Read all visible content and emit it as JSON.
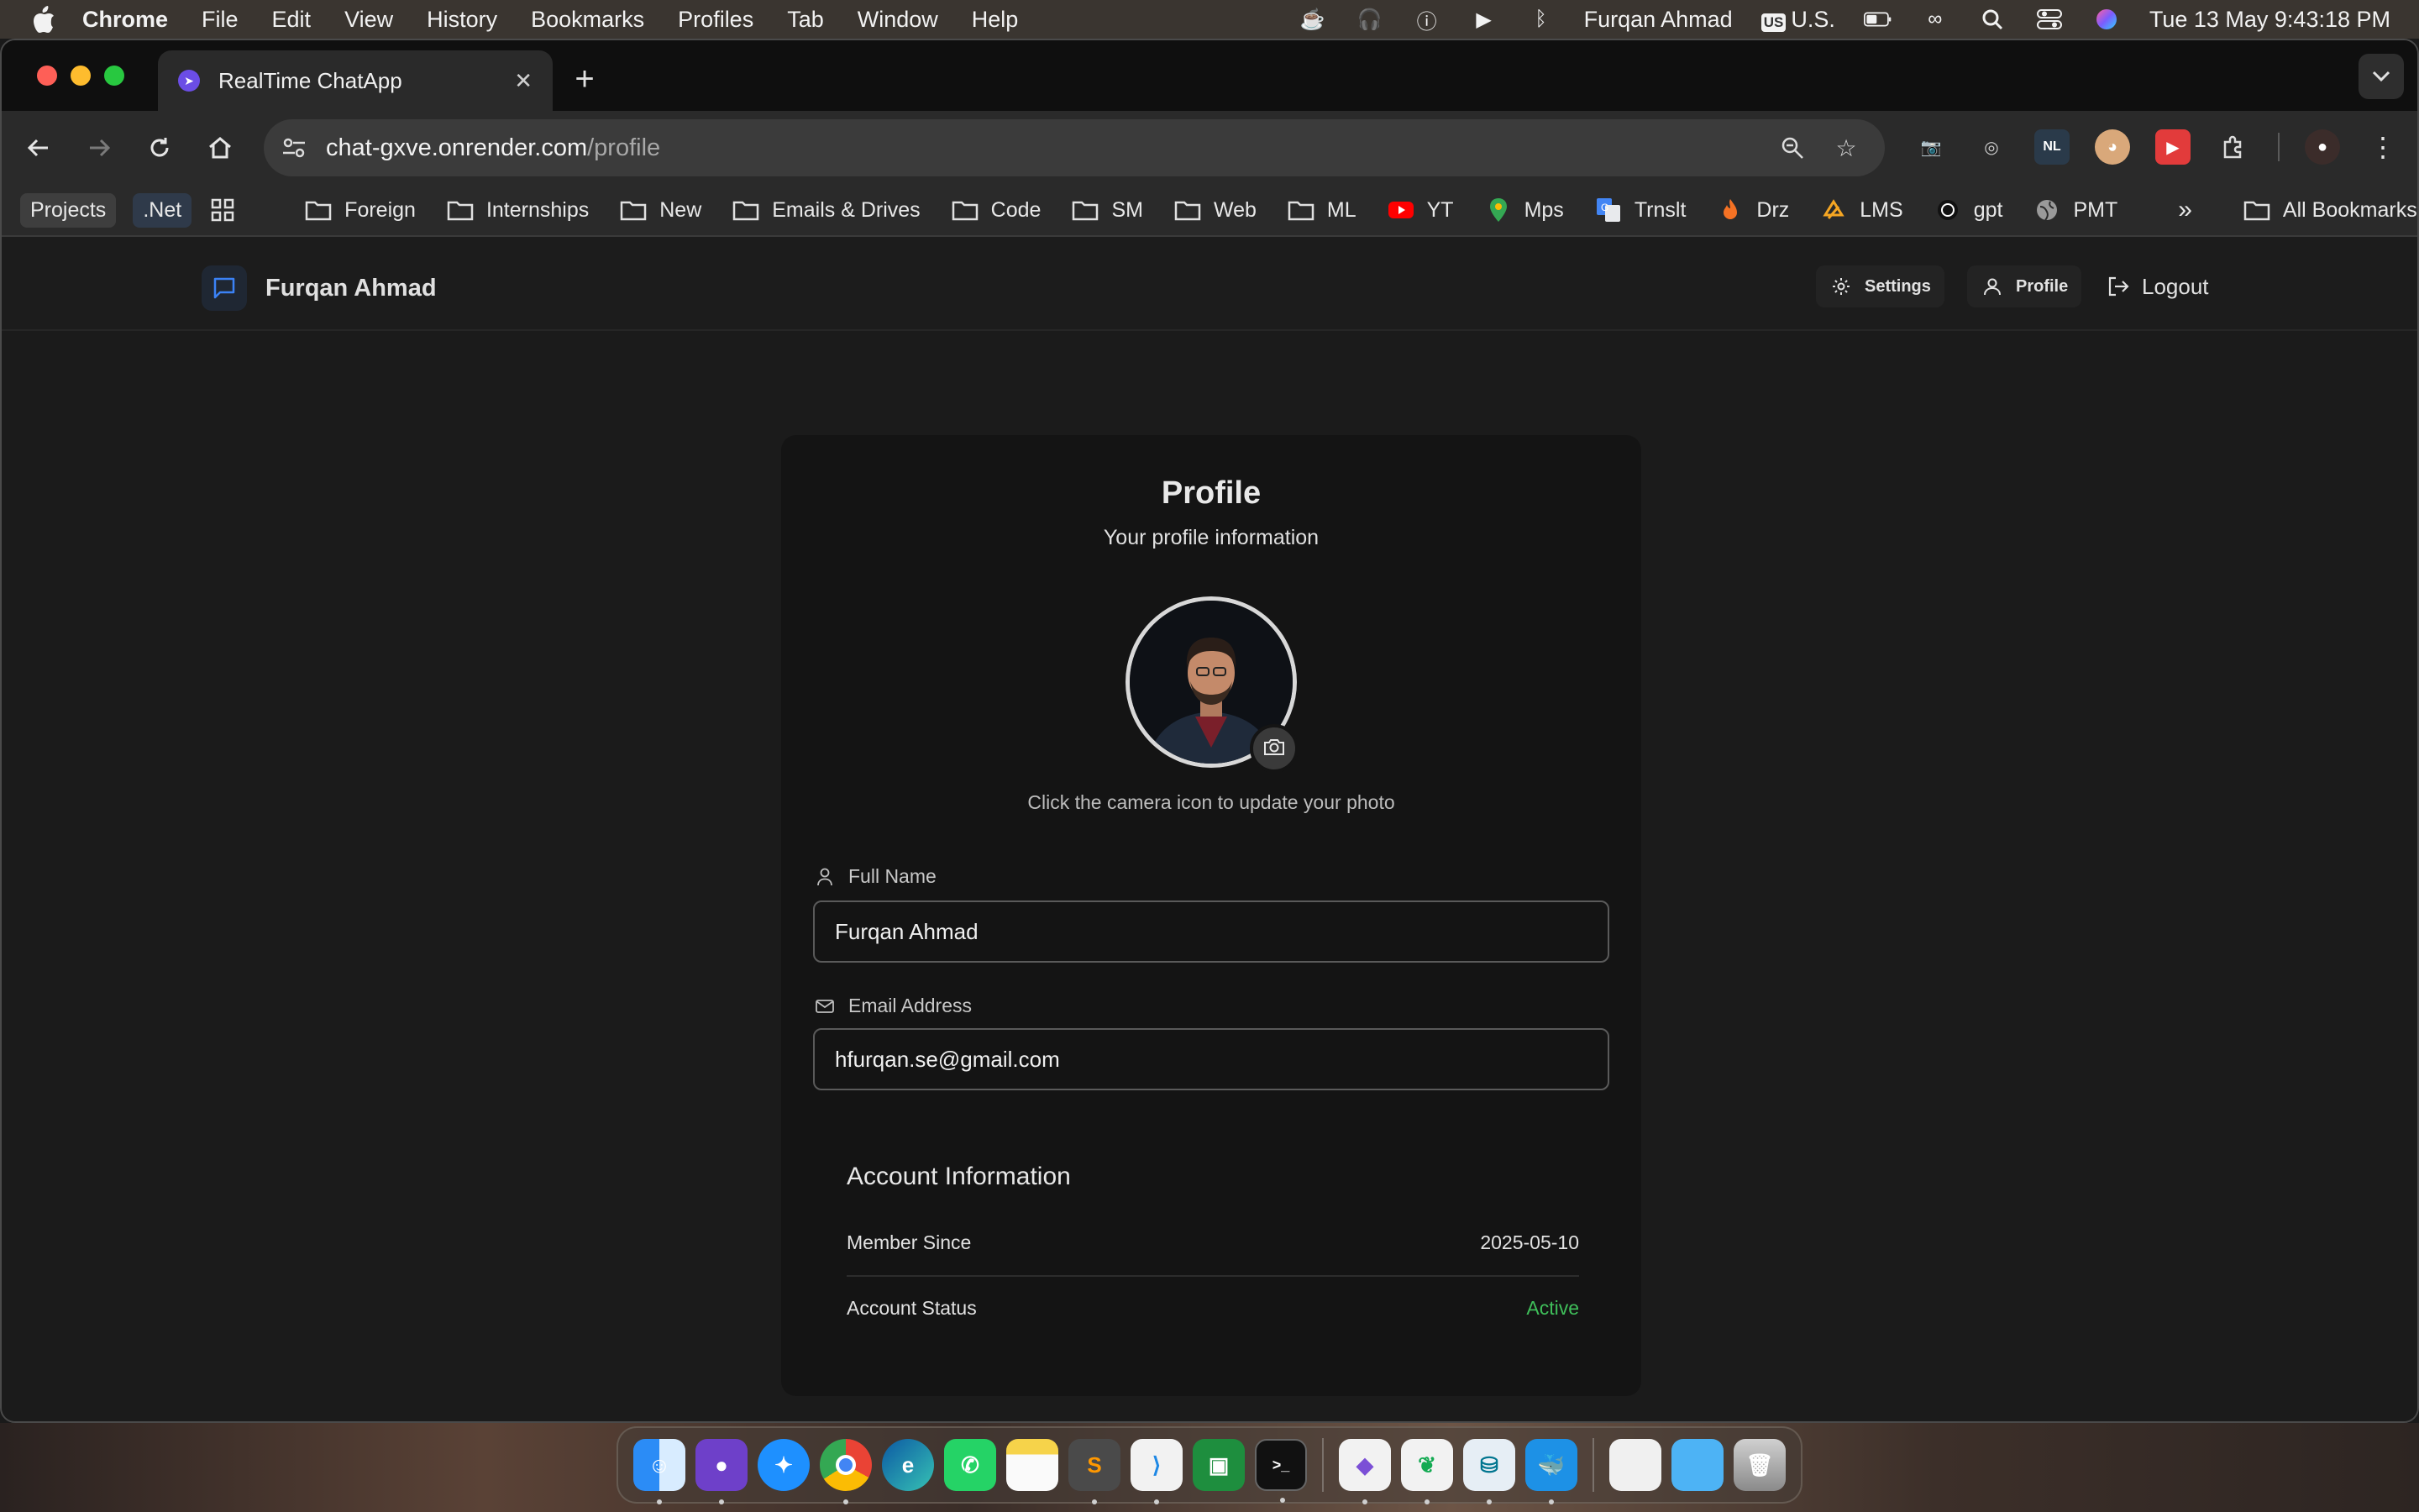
{
  "menubar": {
    "app": "Chrome",
    "items": [
      "File",
      "Edit",
      "View",
      "History",
      "Bookmarks",
      "Profiles",
      "Tab",
      "Window",
      "Help"
    ],
    "user": "Furqan Ahmad",
    "input_source_badge": "US",
    "input_source": "U.S.",
    "datetime": "Tue 13 May  9:43:18 PM"
  },
  "browser": {
    "tab_title": "RealTime ChatApp",
    "url_host": "chat-gxve.onrender.com",
    "url_path": "/profile"
  },
  "bookmarks": {
    "pills": [
      "Projects",
      ".Net"
    ],
    "items": [
      {
        "label": "Foreign",
        "icon": "folder-icon"
      },
      {
        "label": "Internships",
        "icon": "folder-icon"
      },
      {
        "label": "New",
        "icon": "folder-icon"
      },
      {
        "label": "Emails & Drives",
        "icon": "folder-icon"
      },
      {
        "label": "Code",
        "icon": "folder-icon"
      },
      {
        "label": "SM",
        "icon": "folder-icon"
      },
      {
        "label": "Web",
        "icon": "folder-icon"
      },
      {
        "label": "ML",
        "icon": "folder-icon"
      },
      {
        "label": "YT",
        "icon": "youtube-icon"
      },
      {
        "label": "Mps",
        "icon": "maps-icon"
      },
      {
        "label": "Trnslt",
        "icon": "translate-icon"
      },
      {
        "label": "Drz",
        "icon": "daraz-icon"
      },
      {
        "label": "LMS",
        "icon": "lms-icon"
      },
      {
        "label": "gpt",
        "icon": "openai-icon"
      },
      {
        "label": "PMT",
        "icon": "globe-icon"
      }
    ],
    "overflow": "»",
    "all_bookmarks": "All Bookmarks"
  },
  "app_header": {
    "brand": "Furqan Ahmad",
    "settings": "Settings",
    "profile": "Profile",
    "logout": "Logout"
  },
  "profile": {
    "title": "Profile",
    "subtitle": "Your profile information",
    "photo_hint": "Click the camera icon to update your photo",
    "full_name_label": "Full Name",
    "full_name_value": "Furqan Ahmad",
    "email_label": "Email Address",
    "email_value": "hfurqan.se@gmail.com",
    "account_title": "Account Information",
    "member_since_label": "Member Since",
    "member_since_value": "2025-05-10",
    "status_label": "Account Status",
    "status_value": "Active"
  },
  "colors": {
    "status_active": "#3fbf5a",
    "tab_favicon": "#6b4de6"
  },
  "dock": [
    "Finder",
    "GitHub Desktop",
    "Safari",
    "Chrome",
    "Edge",
    "WhatsApp",
    "Notes",
    "Sublime Text",
    "VS Code",
    "Classroom",
    "Terminal",
    "Visual Studio",
    "MongoDB Compass",
    "MySQL Workbench",
    "Docker",
    "Documents",
    "Folder",
    "Trash"
  ]
}
